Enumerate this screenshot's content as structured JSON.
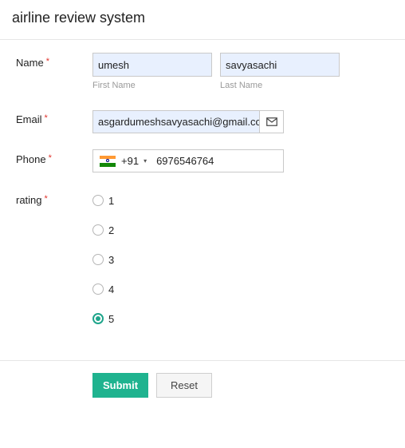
{
  "header": {
    "title": "airline review system"
  },
  "form": {
    "name": {
      "label": "Name",
      "required_mark": "*",
      "first_value": "umesh",
      "first_sublabel": "First Name",
      "last_value": "savyasachi",
      "last_sublabel": "Last Name"
    },
    "email": {
      "label": "Email",
      "required_mark": "*",
      "value": "asgardumeshsavyasachi@gmail.com",
      "icon": "envelope-icon"
    },
    "phone": {
      "label": "Phone",
      "required_mark": "*",
      "country_flag": "india-flag-icon",
      "dial_code": "+91",
      "caret": "▾",
      "value": "6976546764"
    },
    "rating": {
      "label": "rating",
      "required_mark": "*",
      "options": [
        "1",
        "2",
        "3",
        "4",
        "5"
      ],
      "selected": "5"
    }
  },
  "actions": {
    "submit_label": "Submit",
    "reset_label": "Reset"
  },
  "colors": {
    "accent": "#1fb38f",
    "required": "#e0322b",
    "autofill": "#e8f0fe"
  }
}
